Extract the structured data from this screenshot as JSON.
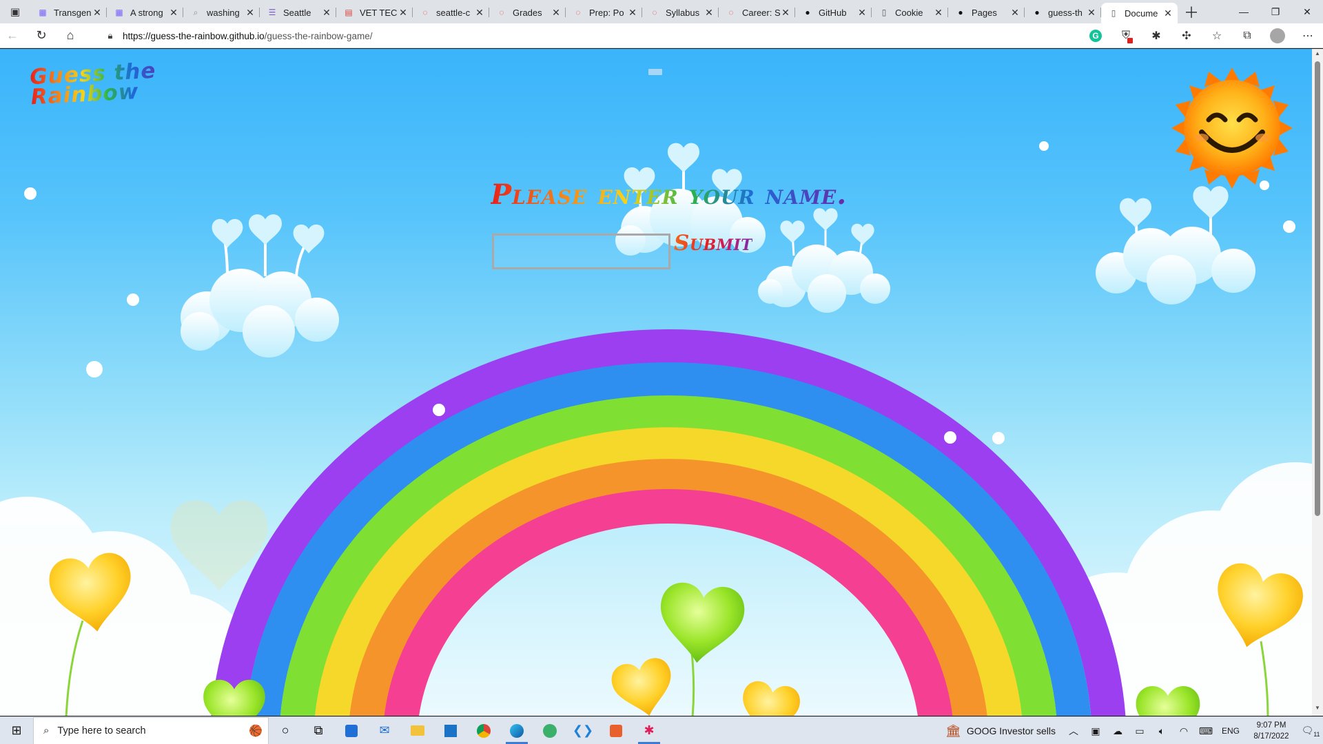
{
  "browser": {
    "tabs": [
      {
        "title": "Transgender",
        "icon": "doc-icon",
        "color": "#7b61ff"
      },
      {
        "title": "A strong",
        "icon": "doc-icon",
        "color": "#7b61ff"
      },
      {
        "title": "washing",
        "icon": "search-icon",
        "color": "#8a8a8a"
      },
      {
        "title": "Seattle",
        "icon": "form-icon",
        "color": "#7a5ccf"
      },
      {
        "title": "VET TEC",
        "icon": "pdf-icon",
        "color": "#d9453c"
      },
      {
        "title": "seattle-c",
        "icon": "canvas-icon",
        "color": "#e03a2e"
      },
      {
        "title": "Grades",
        "icon": "canvas-icon",
        "color": "#e03a2e"
      },
      {
        "title": "Prep: Po",
        "icon": "canvas-icon",
        "color": "#e03a2e"
      },
      {
        "title": "Syllabus",
        "icon": "canvas-icon",
        "color": "#e03a2e"
      },
      {
        "title": "Career: S",
        "icon": "canvas-icon",
        "color": "#e03a2e"
      },
      {
        "title": "GitHub",
        "icon": "github-icon",
        "color": "#111111"
      },
      {
        "title": "Cookie",
        "icon": "page-icon",
        "color": "#555555"
      },
      {
        "title": "Pages",
        "icon": "github-icon",
        "color": "#111111"
      },
      {
        "title": "guess-th",
        "icon": "github-icon",
        "color": "#111111"
      },
      {
        "title": "Docume",
        "icon": "page-icon",
        "color": "#555555",
        "active": true
      }
    ],
    "url_domain": "https://guess-the-rainbow.github.io",
    "url_path": "/guess-the-rainbow-game/"
  },
  "page": {
    "logo_line1": "Guess the",
    "logo_line2": "Rainbow",
    "prompt": "Please enter your name.",
    "name_input_value": "",
    "submit_label": "Submit"
  },
  "taskbar": {
    "search_placeholder": "Type here to search",
    "news_ticker": "GOOG   Investor sells",
    "language": "ENG",
    "time": "9:07 PM",
    "date": "8/17/2022",
    "notification_count": "11"
  }
}
